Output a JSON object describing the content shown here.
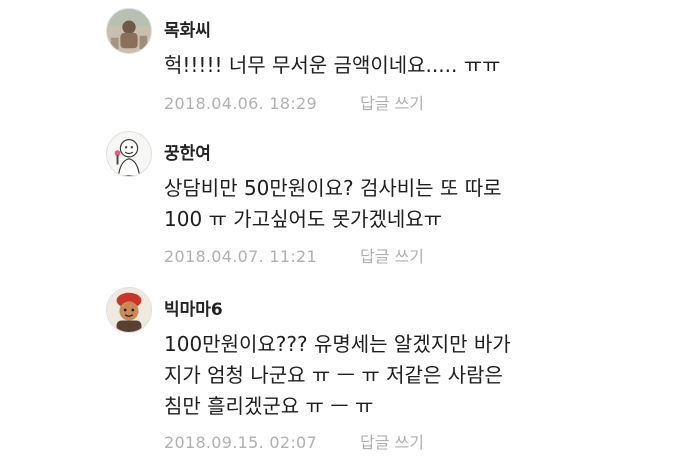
{
  "comments": [
    {
      "author": "목화씨",
      "lines": [
        "헉!!!!! 너무 무서운 금액이네요..... ㅠㅠ"
      ],
      "date": "2018.04.06. 18:29",
      "reply_label": "답글 쓰기",
      "avatar_icon": "photo-avatar-icon"
    },
    {
      "author": "꿍한여",
      "lines": [
        "상담비만 50만원이요? 검사비는 또 따로",
        "100 ㅠ 가고싶어도 못가겠네요ㅠ"
      ],
      "date": "2018.04.07. 11:21",
      "reply_label": "답글 쓰기",
      "avatar_icon": "cartoon-avatar-icon"
    },
    {
      "author": "빅마마6",
      "lines": [
        "100만원이요??? 유명세는 알겠지만 바가",
        "지가 엄청 나군요 ㅠ ㅡ ㅠ 저같은 사람은",
        "침만 흘리겠군요 ㅠ ㅡ ㅠ"
      ],
      "date": "2018.09.15. 02:07",
      "reply_label": "답글 쓰기",
      "avatar_icon": "character-avatar-icon"
    }
  ],
  "colors": {
    "text": "#1e1e1e",
    "meta": "#b0b0b0",
    "background": "#ffffff"
  }
}
